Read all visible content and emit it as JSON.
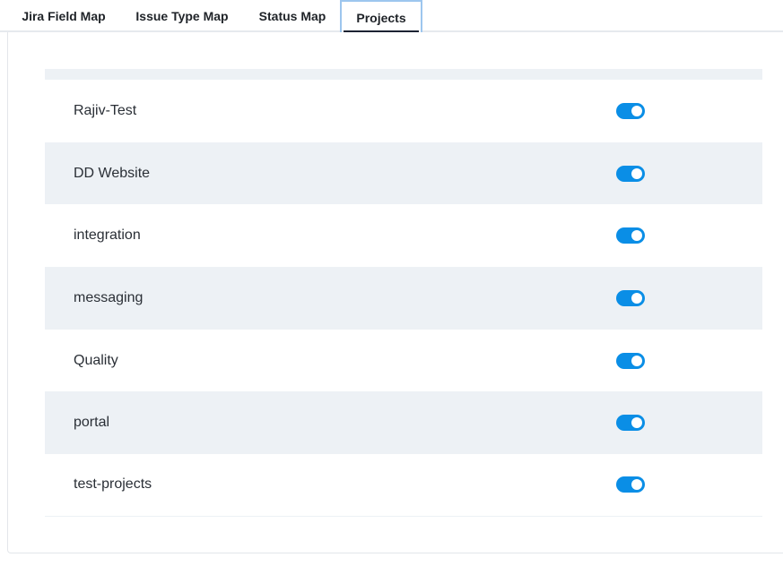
{
  "tabs": [
    {
      "label": "Jira Field Map",
      "active": false
    },
    {
      "label": "Issue Type Map",
      "active": false
    },
    {
      "label": "Status Map",
      "active": false
    },
    {
      "label": "Projects",
      "active": true
    }
  ],
  "projects": [
    {
      "name": "Rajiv-Test",
      "enabled": true
    },
    {
      "name": "DD Website",
      "enabled": true
    },
    {
      "name": "integration",
      "enabled": true
    },
    {
      "name": "messaging",
      "enabled": true
    },
    {
      "name": "Quality",
      "enabled": true
    },
    {
      "name": "portal",
      "enabled": true
    },
    {
      "name": "test-projects",
      "enabled": true
    }
  ],
  "colors": {
    "toggle_on": "#0a8ee6",
    "row_shade": "#edf1f5",
    "active_tab_border": "#9dc6ee"
  }
}
